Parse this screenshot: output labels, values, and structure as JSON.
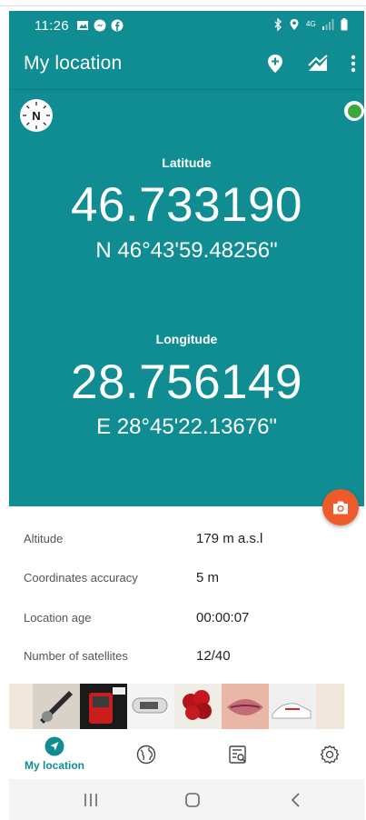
{
  "status_bar": {
    "time": "11:26",
    "left_icons": [
      "image-icon",
      "messenger-icon",
      "facebook-icon"
    ],
    "network_label": "4G",
    "right_icons": [
      "bluetooth-icon",
      "location-icon",
      "network-4g-icon",
      "signal-icon",
      "battery-icon"
    ]
  },
  "app_bar": {
    "title": "My location",
    "actions": [
      "add-location-icon",
      "elevation-icon",
      "more-vert-icon"
    ]
  },
  "latitude": {
    "label": "Latitude",
    "decimal": "46.733190",
    "dms": "N 46°43'59.48256\""
  },
  "longitude": {
    "label": "Longitude",
    "decimal": "28.756149",
    "dms": "E 28°45'22.13676\""
  },
  "compass_letter": "N",
  "info": [
    {
      "label": "Altitude",
      "value": "179 m a.s.l"
    },
    {
      "label": "Coordinates accuracy",
      "value": "5 m"
    },
    {
      "label": "Location age",
      "value": "00:00:07"
    },
    {
      "label": "Number of satellites",
      "value": "12/40"
    }
  ],
  "bottom_nav": {
    "active_label": "My location",
    "items": [
      "navigation-icon",
      "globe-icon",
      "list-search-icon",
      "settings-icon"
    ]
  },
  "colors": {
    "primary": "#108d92",
    "fab": "#ef5a2b",
    "gps_ok": "#3aa93a"
  }
}
